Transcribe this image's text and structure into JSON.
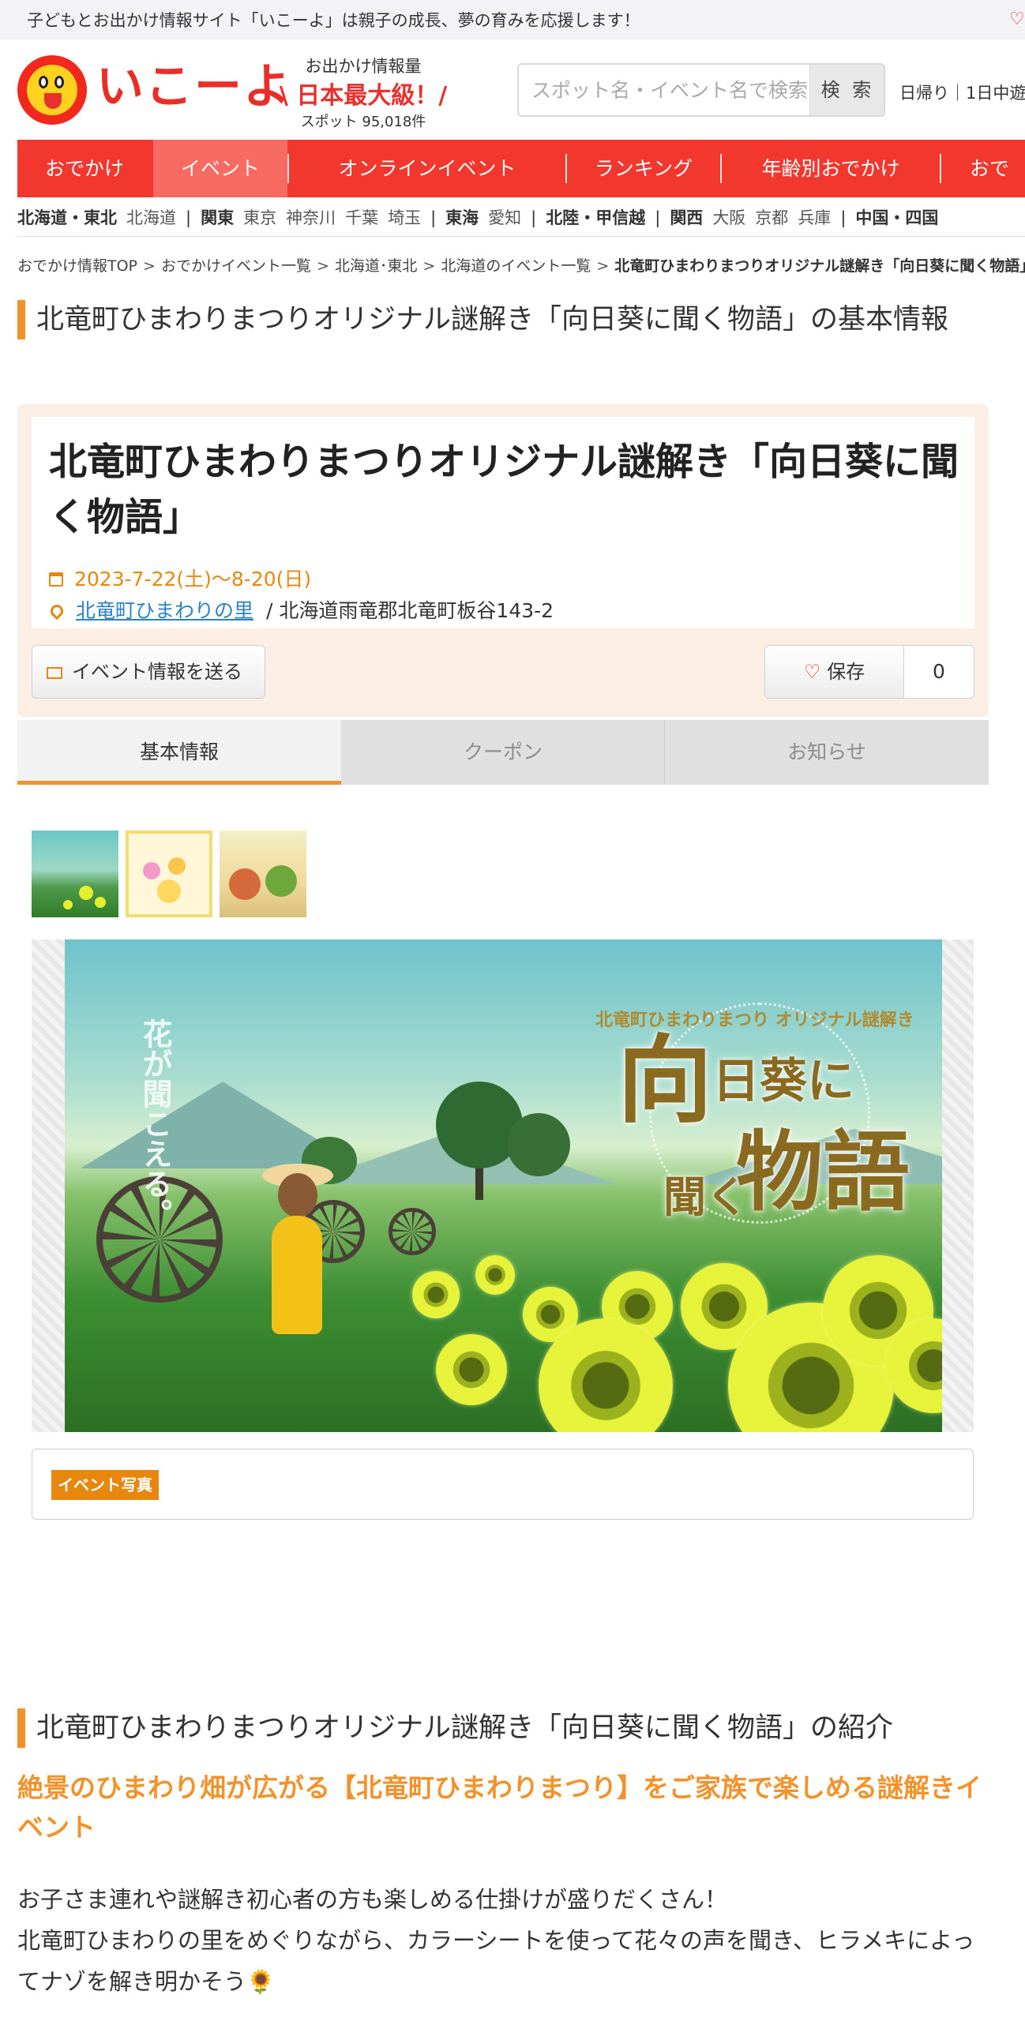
{
  "notice": {
    "text": "子どもとお出かけ情報サイト「いこーよ」は親子の成長、夢の育みを応援します！"
  },
  "header": {
    "logo_text": "いこーよ",
    "count_caption": "お出かけ情報量",
    "count_headline": "\\ 日本最大級！/",
    "spot_count": "スポット 95,018件",
    "search_placeholder": "スポット名・イベント名で検索",
    "search_button": "検 索",
    "links": "日帰り｜1日中遊"
  },
  "nav": {
    "items": [
      {
        "label": "おでかけ",
        "active": false
      },
      {
        "label": "イベント",
        "active": true
      },
      {
        "label": "オンラインイベント",
        "active": false
      },
      {
        "label": "ランキング",
        "active": false
      },
      {
        "label": "年齢別おでかけ",
        "active": false
      },
      {
        "label": "おで",
        "active": false
      }
    ]
  },
  "regions": [
    {
      "main": "北海道・東北",
      "subs": [
        "北海道"
      ]
    },
    {
      "main": "関東",
      "subs": [
        "東京",
        "神奈川",
        "千葉",
        "埼玉"
      ]
    },
    {
      "main": "東海",
      "subs": [
        "愛知"
      ]
    },
    {
      "main": "北陸・甲信越",
      "subs": []
    },
    {
      "main": "関西",
      "subs": [
        "大阪",
        "京都",
        "兵庫"
      ]
    },
    {
      "main": "中国・四国",
      "subs": []
    }
  ],
  "breadcrumb": {
    "items": [
      "おでかけ情報TOP",
      "おでかけイベント一覧",
      "北海道･東北",
      "北海道のイベント一覧"
    ],
    "current": "北竜町ひまわりまつりオリジナル謎解き「向日葵に聞く物語」"
  },
  "basic_info": {
    "heading": "北竜町ひまわりまつりオリジナル謎解き「向日葵に聞く物語」の基本情報",
    "title": "北竜町ひまわりまつりオリジナル謎解き「向日葵に聞く物語」",
    "date": "2023-7-22(土)〜8-20(日)",
    "place_link": "北竜町ひまわりの里",
    "place_sep": "/",
    "address": "北海道雨竜郡北竜町板谷143-2",
    "send_button": "イベント情報を送る",
    "save_button": "保存",
    "save_count": "0"
  },
  "tabs": [
    {
      "label": "基本情報",
      "active": true
    },
    {
      "label": "クーポン",
      "active": false
    },
    {
      "label": "お知らせ",
      "active": false
    }
  ],
  "hero": {
    "vertical_text": "花が聞こえる。",
    "sub_title": "北竜町ひまわりまつり オリジナル謎解き",
    "big_title_1": "向",
    "big_title_2": "日葵に",
    "big_title_3": "聞く",
    "big_title_4": "物語"
  },
  "photo_badge": "イベント写真",
  "intro": {
    "heading": "北竜町ひまわりまつりオリジナル謎解き「向日葵に聞く物語」の紹介",
    "lead": "絶景のひまわり畑が広がる【北竜町ひまわりまつり】をご家族で楽しめる謎解きイベント",
    "body_line1": "お子さま連れや謎解き初心者の方も楽しめる仕掛けが盛りだくさん！",
    "body_line2": "北竜町ひまわりの里をめぐりながら、カラーシートを使って花々の声を聞き、ヒラメキによってナゾを解き明かそう🌻"
  },
  "colors": {
    "brand_red": "#f2372f",
    "accent_orange": "#f3922a",
    "date_orange": "#e8870e",
    "link_blue": "#2a82c6"
  }
}
